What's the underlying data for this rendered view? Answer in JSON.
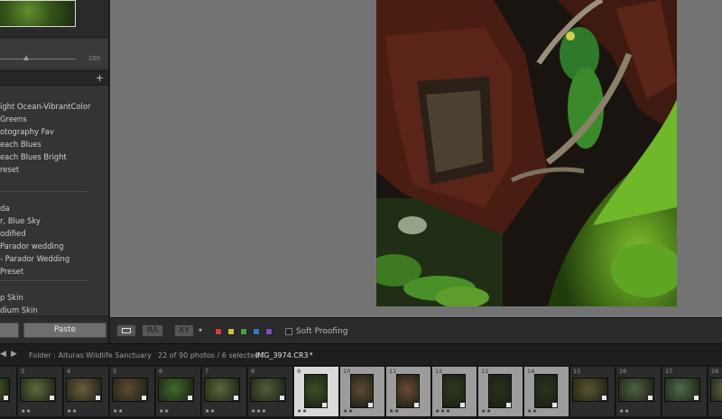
{
  "left_panel": {
    "slider_value": "100",
    "presets_add_icon": "+",
    "preset_groups": [
      [
        "ight Ocean-VibrantColor",
        "Greens",
        "otography Fav",
        "each Blues",
        "each Blues Bright",
        "reset"
      ],
      [
        "da",
        "r, Blue Sky",
        "odified",
        "Parador wedding",
        "- Parador Wedding",
        "Preset"
      ],
      [
        "p Skin",
        "dium Skin"
      ]
    ],
    "buttons": {
      "left_label": "",
      "paste_label": "Paste"
    }
  },
  "toolbar": {
    "compare_label": "XY",
    "survey_label": "RA",
    "soft_proofing_label": "Soft Proofing",
    "color_labels": [
      "#d23c3c",
      "#cfc23a",
      "#44a046",
      "#3a74c9",
      "#7b4fc4"
    ]
  },
  "film_bar": {
    "source": "Folder : Alturas Wildlife Sanctuary",
    "count": "22 of 90 photos / 6 selected /",
    "filename": "IMG_3974.CR3",
    "caret": "▾"
  },
  "filmstrip": {
    "cells": [
      {
        "num": "",
        "state": "normal",
        "orient": "land",
        "stars": "",
        "color": "#4e6a2f"
      },
      {
        "num": "3",
        "state": "normal",
        "orient": "land",
        "stars": "★★",
        "color": "#5a6b3a"
      },
      {
        "num": "4",
        "state": "normal",
        "orient": "land",
        "stars": "★★",
        "color": "#6b5c3e"
      },
      {
        "num": "5",
        "state": "normal",
        "orient": "land",
        "stars": "★★",
        "color": "#5e4a33"
      },
      {
        "num": "6",
        "state": "normal",
        "orient": "land",
        "stars": "★★",
        "color": "#3f6a2a"
      },
      {
        "num": "7",
        "state": "normal",
        "orient": "land",
        "stars": "★★",
        "color": "#59683a"
      },
      {
        "num": "8",
        "state": "normal",
        "orient": "land",
        "stars": "★★★",
        "color": "#4e5f36"
      },
      {
        "num": "9",
        "state": "active",
        "orient": "port",
        "stars": "★★",
        "color": "#3b5024"
      },
      {
        "num": "10",
        "state": "selected",
        "orient": "port",
        "stars": "★★",
        "color": "#5d4a33"
      },
      {
        "num": "11",
        "state": "selected",
        "orient": "port",
        "stars": "★★",
        "color": "#6a4a33"
      },
      {
        "num": "12",
        "state": "selected",
        "orient": "port",
        "stars": "★★★",
        "color": "#2e3a1e"
      },
      {
        "num": "13",
        "state": "selected",
        "orient": "port",
        "stars": "★★",
        "color": "#253119"
      },
      {
        "num": "14",
        "state": "selected",
        "orient": "port",
        "stars": "★★",
        "color": "#283420"
      },
      {
        "num": "15",
        "state": "normal",
        "orient": "land",
        "stars": "",
        "color": "#5b5330"
      },
      {
        "num": "16",
        "state": "normal",
        "orient": "land",
        "stars": "★★",
        "color": "#4d6140"
      },
      {
        "num": "17",
        "state": "normal",
        "orient": "land",
        "stars": "",
        "color": "#4f6a4a"
      },
      {
        "num": "18",
        "state": "normal",
        "orient": "land",
        "stars": "",
        "color": "#5a6a48"
      }
    ]
  }
}
